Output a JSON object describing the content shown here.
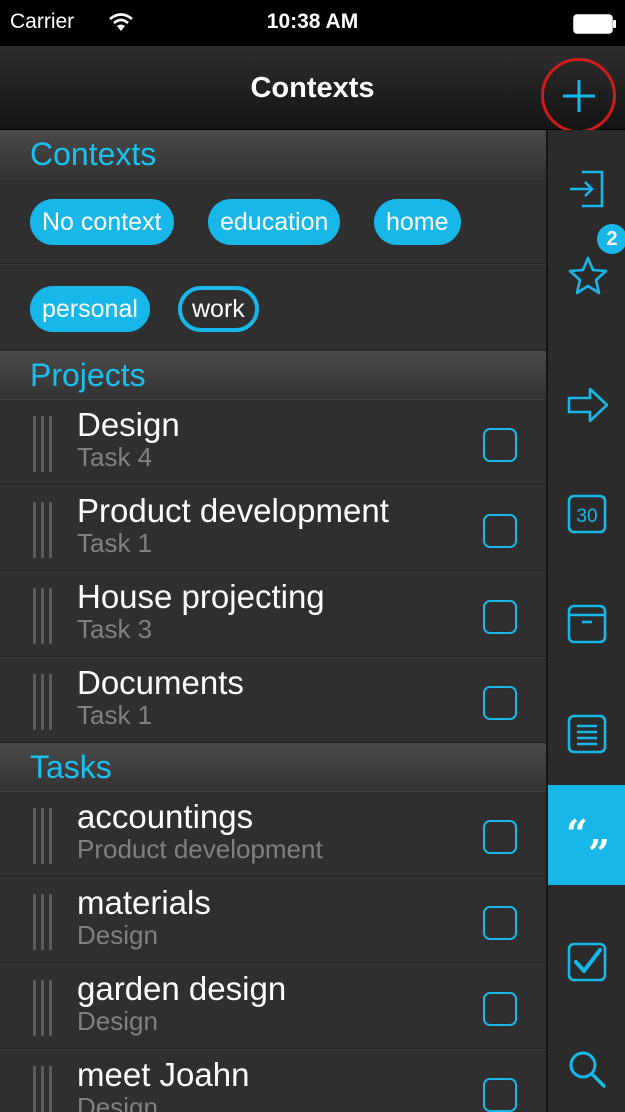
{
  "status_bar": {
    "carrier": "Carrier",
    "time": "10:38 AM"
  },
  "nav": {
    "title": "Contexts"
  },
  "sections": {
    "contexts": "Contexts",
    "projects": "Projects",
    "tasks": "Tasks"
  },
  "contexts": [
    {
      "label": "No context",
      "selected": true
    },
    {
      "label": "education",
      "selected": true
    },
    {
      "label": "home",
      "selected": true
    },
    {
      "label": "personal",
      "selected": true
    },
    {
      "label": "work",
      "selected": false
    }
  ],
  "projects": [
    {
      "title": "Design",
      "subtitle": "Task 4"
    },
    {
      "title": "Product development",
      "subtitle": "Task 1"
    },
    {
      "title": "House projecting",
      "subtitle": "Task 3"
    },
    {
      "title": "Documents",
      "subtitle": "Task 1"
    }
  ],
  "tasks": [
    {
      "title": "accountings",
      "subtitle": "Product development"
    },
    {
      "title": "materials",
      "subtitle": "Design"
    },
    {
      "title": "garden design",
      "subtitle": "Design"
    },
    {
      "title": "meet Joahn",
      "subtitle": "Design"
    }
  ],
  "sidebar": {
    "items": [
      {
        "icon": "inbox-icon"
      },
      {
        "icon": "star-icon",
        "badge": "2"
      },
      {
        "icon": "next-arrow-icon"
      },
      {
        "icon": "calendar-icon",
        "label": "30"
      },
      {
        "icon": "archive-icon"
      },
      {
        "icon": "list-icon"
      },
      {
        "icon": "quote-icon",
        "active": true
      },
      {
        "icon": "checkbox-icon"
      },
      {
        "icon": "search-icon"
      }
    ]
  },
  "colors": {
    "accent": "#18b7ea",
    "highlight_circle": "#d11a1a",
    "background": "#2c2c2c"
  }
}
